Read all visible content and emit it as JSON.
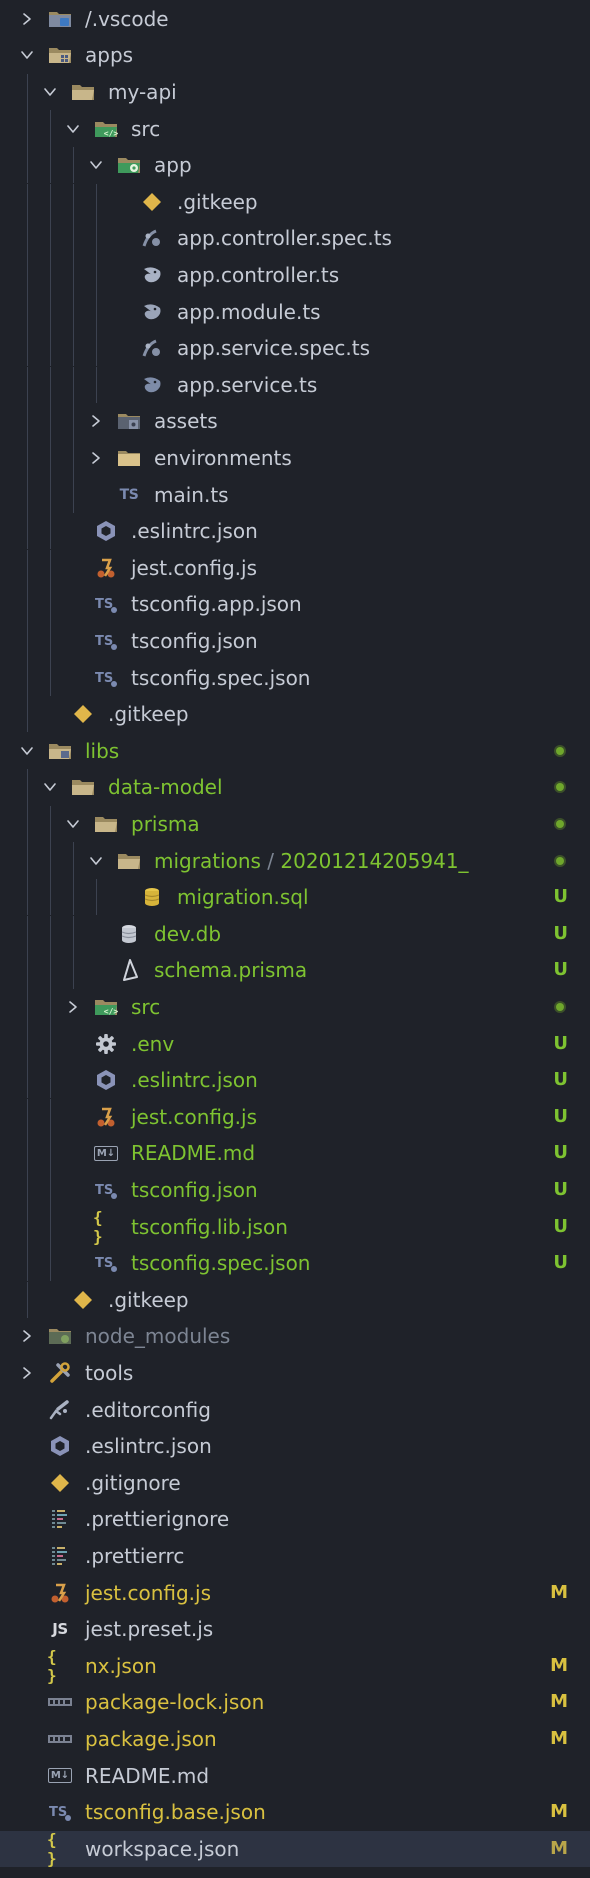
{
  "explorer": {
    "rows": [
      {
        "label": "/.vscode",
        "depth": 0,
        "kind": "folder",
        "expanded": false,
        "icon": "vscode-folder-icon",
        "color": "def"
      },
      {
        "label": "apps",
        "depth": 0,
        "kind": "folder",
        "expanded": true,
        "icon": "apps-folder-icon",
        "color": "def"
      },
      {
        "label": "my-api",
        "depth": 1,
        "kind": "folder",
        "expanded": true,
        "icon": "folder-open-icon",
        "color": "def"
      },
      {
        "label": "src",
        "depth": 2,
        "kind": "folder",
        "expanded": true,
        "icon": "src-folder-icon",
        "color": "def"
      },
      {
        "label": "app",
        "depth": 3,
        "kind": "folder",
        "expanded": true,
        "icon": "app-folder-icon",
        "color": "def"
      },
      {
        "label": ".gitkeep",
        "depth": 4,
        "kind": "file",
        "icon": "gitkeep-icon",
        "color": "def"
      },
      {
        "label": "app.controller.spec.ts",
        "depth": 4,
        "kind": "file",
        "icon": "spec-test-icon",
        "color": "def"
      },
      {
        "label": "app.controller.ts",
        "depth": 4,
        "kind": "file",
        "icon": "nest-controller-icon",
        "color": "def"
      },
      {
        "label": "app.module.ts",
        "depth": 4,
        "kind": "file",
        "icon": "nest-module-icon",
        "color": "def"
      },
      {
        "label": "app.service.spec.ts",
        "depth": 4,
        "kind": "file",
        "icon": "spec-test-icon",
        "color": "def"
      },
      {
        "label": "app.service.ts",
        "depth": 4,
        "kind": "file",
        "icon": "nest-service-icon",
        "color": "def"
      },
      {
        "label": "assets",
        "depth": 3,
        "kind": "folder",
        "expanded": false,
        "icon": "assets-folder-icon",
        "color": "def"
      },
      {
        "label": "environments",
        "depth": 3,
        "kind": "folder",
        "expanded": false,
        "icon": "folder-icon",
        "color": "def"
      },
      {
        "label": "main.ts",
        "depth": 3,
        "kind": "file",
        "icon": "typescript-icon",
        "color": "def"
      },
      {
        "label": ".eslintrc.json",
        "depth": 2,
        "kind": "file",
        "icon": "eslint-icon",
        "color": "def"
      },
      {
        "label": "jest.config.js",
        "depth": 2,
        "kind": "file",
        "icon": "jest-icon",
        "color": "def"
      },
      {
        "label": "tsconfig.app.json",
        "depth": 2,
        "kind": "file",
        "icon": "tsconfig-icon",
        "color": "def"
      },
      {
        "label": "tsconfig.json",
        "depth": 2,
        "kind": "file",
        "icon": "tsconfig-icon",
        "color": "def"
      },
      {
        "label": "tsconfig.spec.json",
        "depth": 2,
        "kind": "file",
        "icon": "tsconfig-icon",
        "color": "def"
      },
      {
        "label": ".gitkeep",
        "depth": 1,
        "kind": "file",
        "icon": "gitkeep-icon",
        "color": "def"
      },
      {
        "label": "libs",
        "depth": 0,
        "kind": "folder",
        "expanded": true,
        "icon": "libs-folder-icon",
        "color": "new",
        "dot": true
      },
      {
        "label": "data-model",
        "depth": 1,
        "kind": "folder",
        "expanded": true,
        "icon": "folder-open-icon",
        "color": "new",
        "dot": true
      },
      {
        "label": "prisma",
        "depth": 2,
        "kind": "folder",
        "expanded": true,
        "icon": "folder-open-icon",
        "color": "new",
        "dot": true
      },
      {
        "label": "migrations",
        "label_suffix": "20201214205941_",
        "depth": 3,
        "kind": "folder",
        "expanded": true,
        "icon": "folder-open-icon",
        "color": "new",
        "dot": true
      },
      {
        "label": "migration.sql",
        "depth": 4,
        "kind": "file",
        "icon": "database-icon",
        "color": "new",
        "status": "U"
      },
      {
        "label": "dev.db",
        "depth": 3,
        "kind": "file",
        "icon": "database-gray-icon",
        "color": "new",
        "status": "U"
      },
      {
        "label": "schema.prisma",
        "depth": 3,
        "kind": "file",
        "icon": "prisma-icon",
        "color": "new",
        "status": "U"
      },
      {
        "label": "src",
        "depth": 2,
        "kind": "folder",
        "expanded": false,
        "icon": "src-folder-icon",
        "color": "new",
        "dot": true
      },
      {
        "label": ".env",
        "depth": 2,
        "kind": "file",
        "icon": "gear-icon",
        "color": "new",
        "status": "U"
      },
      {
        "label": ".eslintrc.json",
        "depth": 2,
        "kind": "file",
        "icon": "eslint-icon",
        "color": "new",
        "status": "U"
      },
      {
        "label": "jest.config.js",
        "depth": 2,
        "kind": "file",
        "icon": "jest-icon",
        "color": "new",
        "status": "U"
      },
      {
        "label": "README.md",
        "depth": 2,
        "kind": "file",
        "icon": "markdown-icon",
        "color": "new",
        "status": "U"
      },
      {
        "label": "tsconfig.json",
        "depth": 2,
        "kind": "file",
        "icon": "tsconfig-icon",
        "color": "new",
        "status": "U"
      },
      {
        "label": "tsconfig.lib.json",
        "depth": 2,
        "kind": "file",
        "icon": "json-icon",
        "color": "new",
        "status": "U"
      },
      {
        "label": "tsconfig.spec.json",
        "depth": 2,
        "kind": "file",
        "icon": "tsconfig-icon",
        "color": "new",
        "status": "U"
      },
      {
        "label": ".gitkeep",
        "depth": 1,
        "kind": "file",
        "icon": "gitkeep-icon",
        "color": "def"
      },
      {
        "label": "node_modules",
        "depth": 0,
        "kind": "folder",
        "expanded": false,
        "icon": "node-folder-icon",
        "color": "dim"
      },
      {
        "label": "tools",
        "depth": 0,
        "kind": "folder",
        "expanded": false,
        "icon": "tools-folder-icon",
        "color": "def"
      },
      {
        "label": ".editorconfig",
        "depth": 0,
        "kind": "file",
        "icon": "editorconfig-icon",
        "color": "def"
      },
      {
        "label": ".eslintrc.json",
        "depth": 0,
        "kind": "file",
        "icon": "eslint-icon",
        "color": "def"
      },
      {
        "label": ".gitignore",
        "depth": 0,
        "kind": "file",
        "icon": "gitkeep-icon",
        "color": "def"
      },
      {
        "label": ".prettierignore",
        "depth": 0,
        "kind": "file",
        "icon": "prettier-icon",
        "color": "def"
      },
      {
        "label": ".prettierrc",
        "depth": 0,
        "kind": "file",
        "icon": "prettier-icon",
        "color": "def"
      },
      {
        "label": "jest.config.js",
        "depth": 0,
        "kind": "file",
        "icon": "jest-icon",
        "color": "mod",
        "status": "M"
      },
      {
        "label": "jest.preset.js",
        "depth": 0,
        "kind": "file",
        "icon": "javascript-icon",
        "color": "def"
      },
      {
        "label": "nx.json",
        "depth": 0,
        "kind": "file",
        "icon": "json-icon",
        "color": "mod",
        "status": "M"
      },
      {
        "label": "package-lock.json",
        "depth": 0,
        "kind": "file",
        "icon": "npm-icon",
        "color": "mod",
        "status": "M"
      },
      {
        "label": "package.json",
        "depth": 0,
        "kind": "file",
        "icon": "npm-icon",
        "color": "mod",
        "status": "M"
      },
      {
        "label": "README.md",
        "depth": 0,
        "kind": "file",
        "icon": "markdown-icon",
        "color": "def"
      },
      {
        "label": "tsconfig.base.json",
        "depth": 0,
        "kind": "file",
        "icon": "tsconfig-icon",
        "color": "mod",
        "status": "M"
      },
      {
        "label": "workspace.json",
        "depth": 0,
        "kind": "file",
        "icon": "json-icon",
        "color": "def",
        "status": "M",
        "selected": true
      }
    ]
  },
  "colors": {
    "background": "#1f2229",
    "selected_row": "#2d3342",
    "untracked_green": "#7ec331",
    "modified_yellow": "#d9c140",
    "default_text": "#c6cbd5",
    "dim_text": "#7d8593"
  }
}
